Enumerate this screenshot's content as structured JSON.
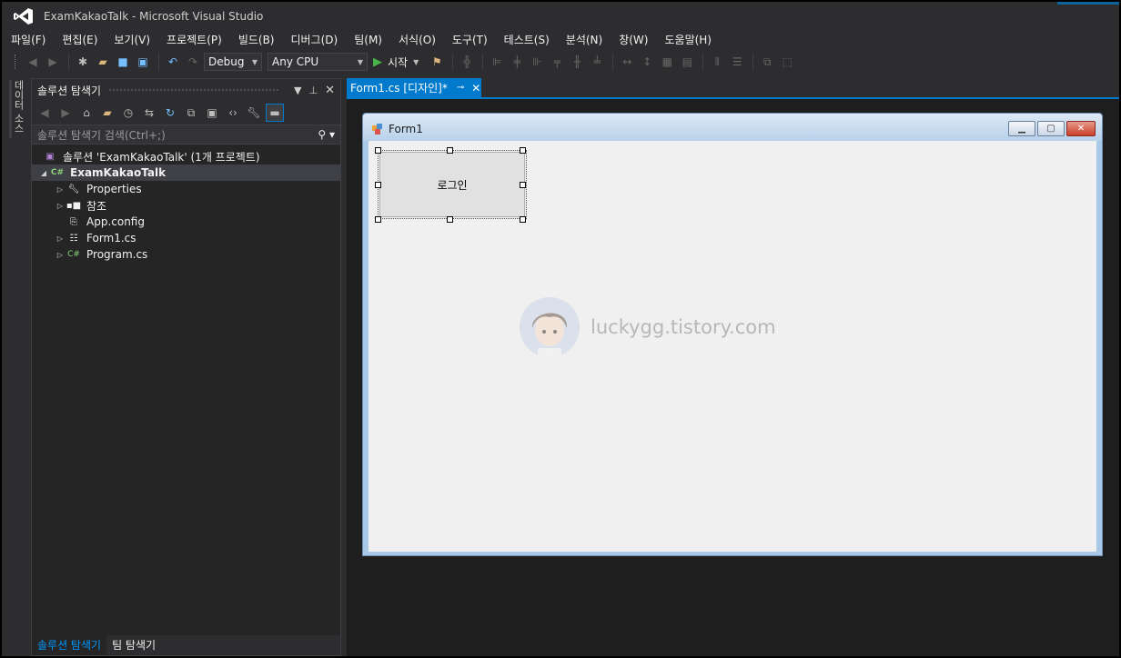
{
  "window": {
    "title": "ExamKakaoTalk - Microsoft Visual Studio"
  },
  "menu": [
    "파일(F)",
    "편집(E)",
    "보기(V)",
    "프로젝트(P)",
    "빌드(B)",
    "디버그(D)",
    "팀(M)",
    "서식(O)",
    "도구(T)",
    "테스트(S)",
    "분석(N)",
    "창(W)",
    "도움말(H)"
  ],
  "toolbar": {
    "config": "Debug",
    "platform": "Any CPU",
    "start_label": "시작"
  },
  "side_strip": {
    "tab_label": "데이터 소스"
  },
  "solution_explorer": {
    "title": "솔루션 탐색기",
    "search_placeholder": "솔루션 탐색기 검색(Ctrl+;)",
    "tree": [
      {
        "label": "솔루션 'ExamKakaoTalk' (1개 프로젝트)",
        "icon": "solution-icon"
      },
      {
        "label": "ExamKakaoTalk",
        "icon": "csharp-project-icon"
      },
      {
        "label": "Properties",
        "icon": "wrench-icon"
      },
      {
        "label": "참조",
        "icon": "references-icon"
      },
      {
        "label": "App.config",
        "icon": "config-file-icon"
      },
      {
        "label": "Form1.cs",
        "icon": "form-file-icon"
      },
      {
        "label": "Program.cs",
        "icon": "csharp-file-icon"
      }
    ],
    "bottom_tabs": [
      "솔루션 탐색기",
      "팀 탐색기"
    ]
  },
  "document_tab": {
    "label": "Form1.cs [디자인]*"
  },
  "form": {
    "title": "Form1",
    "button_label": "로그인"
  },
  "watermark": {
    "text": "luckygg.tistory.com"
  },
  "colors": {
    "accent": "#007acc",
    "background": "#2d2d30",
    "panel": "#252526",
    "form_client": "#f0f0f0"
  }
}
